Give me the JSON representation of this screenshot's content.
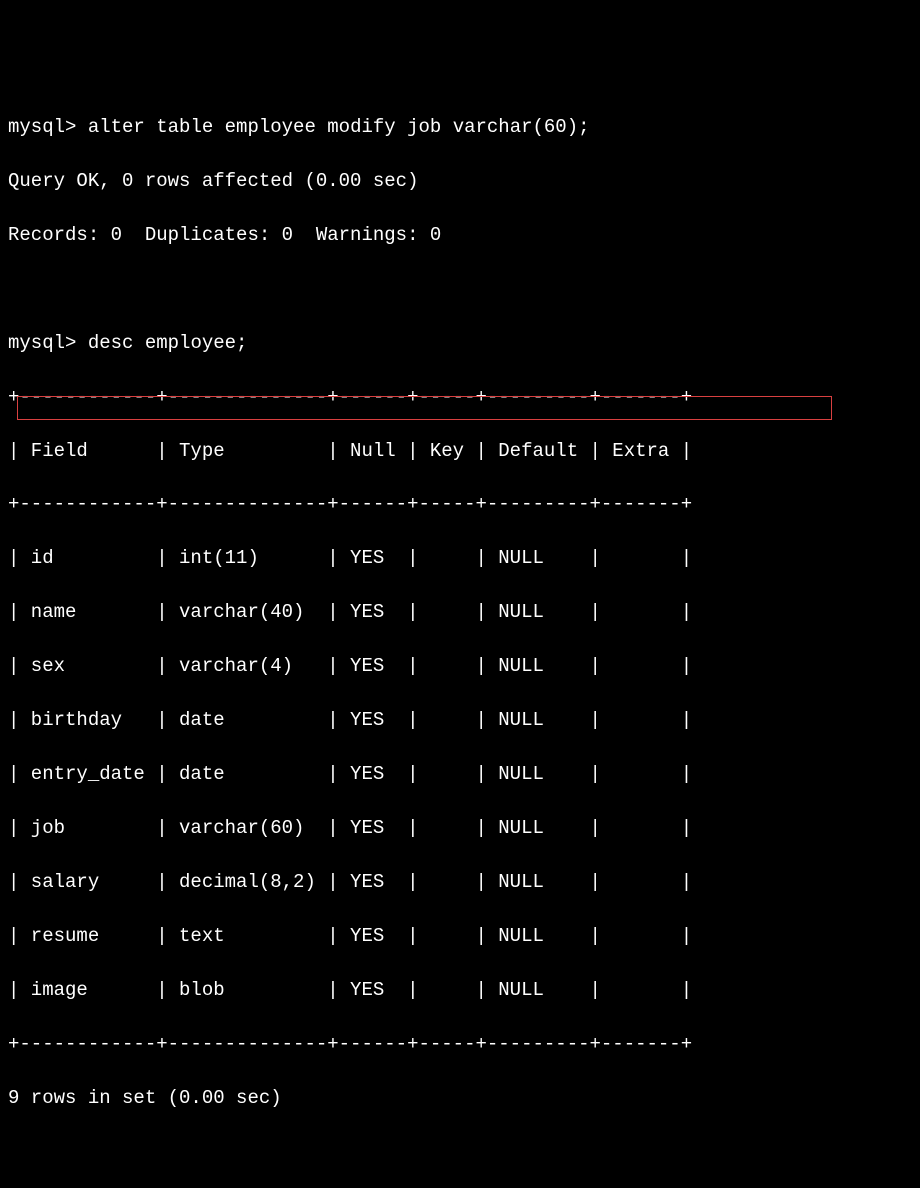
{
  "prompt": "mysql>",
  "command1": "alter table employee modify job varchar(60);",
  "result1_line1": "Query OK, 0 rows affected (0.00 sec)",
  "result1_line2": "Records: 0  Duplicates: 0  Warnings: 0",
  "command2": "desc employee;",
  "table": {
    "border_top": "+------------+--------------+------+-----+---------+-------+",
    "header": "| Field      | Type         | Null | Key | Default | Extra |",
    "border_header": "+------------+--------------+------+-----+---------+-------+",
    "rows": [
      "| id         | int(11)      | YES  |     | NULL    |       |",
      "| name       | varchar(40)  | YES  |     | NULL    |       |",
      "| sex        | varchar(4)   | YES  |     | NULL    |       |",
      "| birthday   | date         | YES  |     | NULL    |       |",
      "| entry_date | date         | YES  |     | NULL    |       |",
      "| job        | varchar(60)  | YES  |     | NULL    |       |",
      "| salary     | decimal(8,2) | YES  |     | NULL    |       |",
      "| resume     | text         | YES  |     | NULL    |       |",
      "| image      | blob         | YES  |     | NULL    |       |"
    ],
    "border_bottom": "+------------+--------------+------+-----+---------+-------+"
  },
  "footer": "9 rows in set (0.00 sec)",
  "columns": [
    "Field",
    "Type",
    "Null",
    "Key",
    "Default",
    "Extra"
  ],
  "data_rows": [
    {
      "Field": "id",
      "Type": "int(11)",
      "Null": "YES",
      "Key": "",
      "Default": "NULL",
      "Extra": ""
    },
    {
      "Field": "name",
      "Type": "varchar(40)",
      "Null": "YES",
      "Key": "",
      "Default": "NULL",
      "Extra": ""
    },
    {
      "Field": "sex",
      "Type": "varchar(4)",
      "Null": "YES",
      "Key": "",
      "Default": "NULL",
      "Extra": ""
    },
    {
      "Field": "birthday",
      "Type": "date",
      "Null": "YES",
      "Key": "",
      "Default": "NULL",
      "Extra": ""
    },
    {
      "Field": "entry_date",
      "Type": "date",
      "Null": "YES",
      "Key": "",
      "Default": "NULL",
      "Extra": ""
    },
    {
      "Field": "job",
      "Type": "varchar(60)",
      "Null": "YES",
      "Key": "",
      "Default": "NULL",
      "Extra": ""
    },
    {
      "Field": "salary",
      "Type": "decimal(8,2)",
      "Null": "YES",
      "Key": "",
      "Default": "NULL",
      "Extra": ""
    },
    {
      "Field": "resume",
      "Type": "text",
      "Null": "YES",
      "Key": "",
      "Default": "NULL",
      "Extra": ""
    },
    {
      "Field": "image",
      "Type": "blob",
      "Null": "YES",
      "Key": "",
      "Default": "NULL",
      "Extra": ""
    }
  ],
  "highlight_row_index": 5
}
